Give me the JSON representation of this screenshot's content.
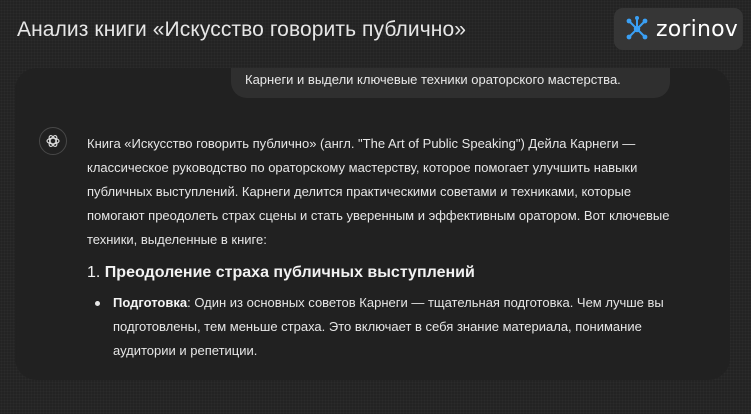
{
  "page": {
    "title": "Анализ книги «Искусство говорить публично»"
  },
  "brand": {
    "name": "zorinov",
    "icon": "network-nodes-icon",
    "color": "#3aa0f5"
  },
  "user_message": {
    "visible_text": "Карнеги и выдели ключевые техники ораторского мастерства."
  },
  "assistant": {
    "avatar_icon": "openai-logo-icon",
    "intro_lines": [
      "Книга «Искусство говорить публично» (англ. \"The Art of Public Speaking\") Дейла Карнеги —",
      "классическое руководство по ораторскому мастерству, которое помогает улучшить навыки",
      "публичных выступлений. Карнеги делится практическими советами и техниками, которые",
      "помогают преодолеть страх сцены и стать уверенным и эффективным оратором. Вот ключевые",
      "техники, выделенные в книге:"
    ],
    "section_number": "1.",
    "section_title": "Преодоление страха публичных выступлений",
    "bullet": {
      "term": "Подготовка",
      "line1_rest": ": Один из основных советов Карнеги — тщательная подготовка. Чем лучше вы",
      "line2": "подготовлены, тем меньше страха. Это включает в себя знание материала, понимание",
      "line3": "аудитории и репетиции."
    },
    "faded_line": "В                              В"
  }
}
